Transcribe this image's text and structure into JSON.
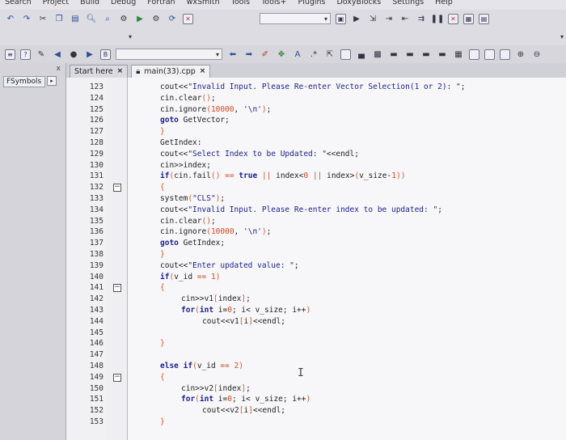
{
  "menu": [
    "Search",
    "Project",
    "Build",
    "Debug",
    "Fortran",
    "wxSmith",
    "Tools",
    "Tools+",
    "Plugins",
    "DoxyBlocks",
    "Settings",
    "Help"
  ],
  "left_panel": {
    "tab_label": "FSymbols",
    "close_glyph": "x"
  },
  "tabs": [
    {
      "label": "Start here",
      "active": false
    },
    {
      "label": "main(33).cpp",
      "active": true
    }
  ],
  "editor": {
    "lines": [
      {
        "num": "123",
        "fold": false,
        "indent": 40,
        "code": "cout<<\"Invalid Input. Please Re-enter Vector Selection(1 or 2): \";"
      },
      {
        "num": "124",
        "fold": false,
        "indent": 40,
        "code": "cin.clear();"
      },
      {
        "num": "125",
        "fold": false,
        "indent": 40,
        "code": "cin.ignore(10000, '\\n');"
      },
      {
        "num": "126",
        "fold": false,
        "indent": 40,
        "code": "goto GetVector;"
      },
      {
        "num": "127",
        "fold": false,
        "indent": 40,
        "code": "}"
      },
      {
        "num": "128",
        "fold": false,
        "indent": 40,
        "code": "GetIndex:"
      },
      {
        "num": "129",
        "fold": false,
        "indent": 40,
        "code": "cout<<\"Select Index to be Updated: \"<<endl;"
      },
      {
        "num": "130",
        "fold": false,
        "indent": 40,
        "code": "cin>>index;"
      },
      {
        "num": "131",
        "fold": false,
        "indent": 40,
        "code": "if(cin.fail() == true || index<0 || index>(v_size-1))"
      },
      {
        "num": "132",
        "fold": true,
        "indent": 40,
        "code": "{"
      },
      {
        "num": "133",
        "fold": false,
        "indent": 40,
        "code": "system(\"CLS\");"
      },
      {
        "num": "134",
        "fold": false,
        "indent": 40,
        "code": "cout<<\"Invalid Input. Please Re-enter index to be updated: \";"
      },
      {
        "num": "135",
        "fold": false,
        "indent": 40,
        "code": "cin.clear();"
      },
      {
        "num": "136",
        "fold": false,
        "indent": 40,
        "code": "cin.ignore(10000, '\\n');"
      },
      {
        "num": "137",
        "fold": false,
        "indent": 40,
        "code": "goto GetIndex;"
      },
      {
        "num": "138",
        "fold": false,
        "indent": 40,
        "code": "}"
      },
      {
        "num": "139",
        "fold": false,
        "indent": 40,
        "code": "cout<<\"Enter updated value: \";"
      },
      {
        "num": "140",
        "fold": false,
        "indent": 40,
        "code": "if(v_id == 1)"
      },
      {
        "num": "141",
        "fold": true,
        "indent": 40,
        "code": "{"
      },
      {
        "num": "142",
        "fold": false,
        "indent": 66,
        "code": "cin>>v1[index];"
      },
      {
        "num": "143",
        "fold": false,
        "indent": 66,
        "code": "for(int i=0; i< v_size; i++)"
      },
      {
        "num": "144",
        "fold": false,
        "indent": 92,
        "code": "cout<<v1[i]<<endl;"
      },
      {
        "num": "145",
        "fold": false,
        "indent": 40,
        "code": ""
      },
      {
        "num": "146",
        "fold": false,
        "indent": 40,
        "code": "}"
      },
      {
        "num": "147",
        "fold": false,
        "indent": 40,
        "code": ""
      },
      {
        "num": "148",
        "fold": false,
        "indent": 40,
        "code": "else if(v_id == 2)"
      },
      {
        "num": "149",
        "fold": true,
        "indent": 40,
        "code": "{"
      },
      {
        "num": "150",
        "fold": false,
        "indent": 66,
        "code": "cin>>v2[index];"
      },
      {
        "num": "151",
        "fold": false,
        "indent": 66,
        "code": "for(int i=0; i< v_size; i++)"
      },
      {
        "num": "152",
        "fold": false,
        "indent": 92,
        "code": "cout<<v2[i]<<endl;"
      },
      {
        "num": "153",
        "fold": false,
        "indent": 40,
        "code": "}"
      }
    ]
  }
}
